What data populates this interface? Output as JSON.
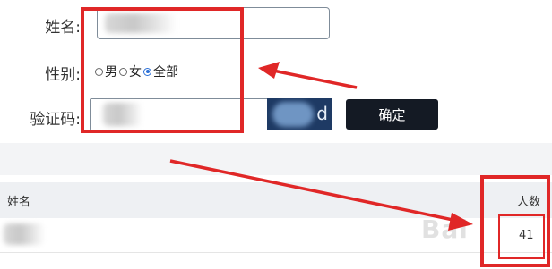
{
  "form": {
    "name_label": "姓名:",
    "gender_label": "性别:",
    "gender_options": [
      "男",
      "女",
      "全部"
    ],
    "gender_selected": "全部",
    "captcha_label": "验证码:",
    "confirm_label": "确定"
  },
  "table": {
    "columns": [
      "姓名",
      "人数"
    ],
    "rows": [
      {
        "count": "41"
      }
    ]
  },
  "watermark": "Bai",
  "annotation_color": "#e02727"
}
